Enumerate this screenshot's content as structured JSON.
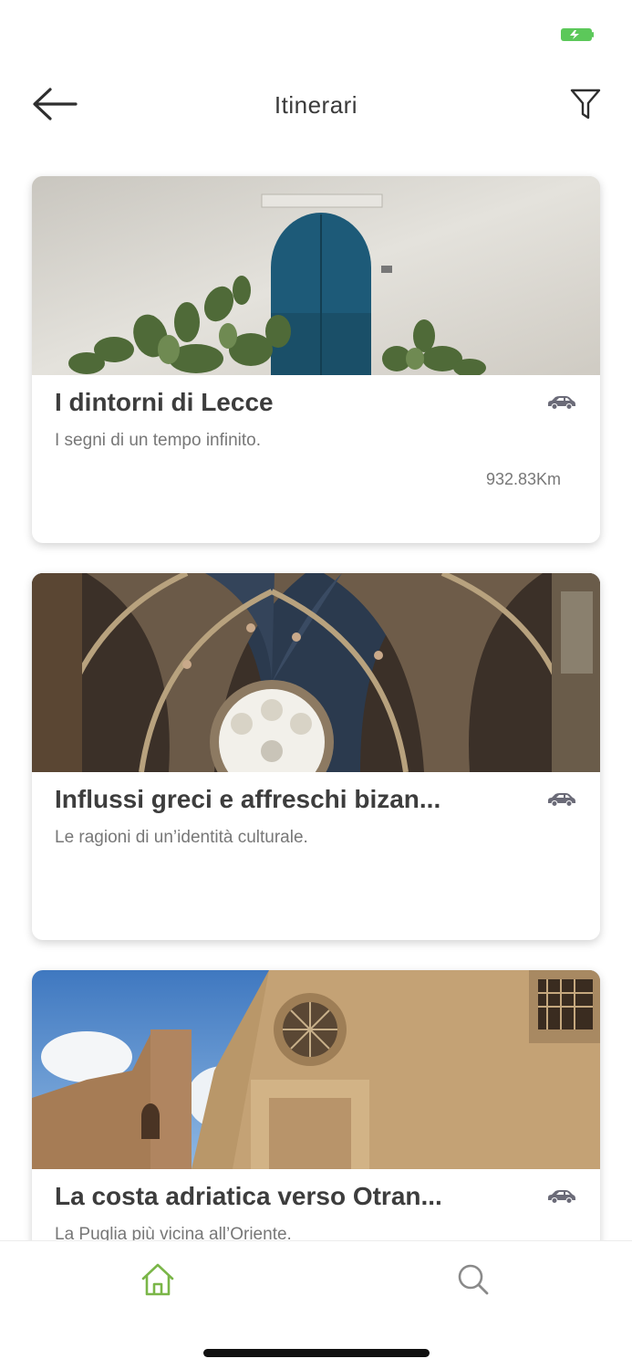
{
  "status_bar": {
    "battery_icon": "battery-charging-icon",
    "battery_color": "#5cc85a"
  },
  "header": {
    "title": "Itinerari",
    "back_icon": "arrow-left-icon",
    "filter_icon": "filter-icon"
  },
  "itineraries": [
    {
      "title": "I dintorni di Lecce",
      "subtitle": "I segni di un tempo infinito.",
      "distance": "932.83Km",
      "transport_icon": "car-icon",
      "image": "whitewashed-wall-blue-door-cactus"
    },
    {
      "title": "Influssi greci e affreschi bizan...",
      "subtitle": "Le ragioni di un’identità culturale.",
      "distance": "",
      "transport_icon": "car-icon",
      "image": "frescoed-vaulted-ceiling"
    },
    {
      "title": "La costa adriatica verso Otran...",
      "subtitle": "La Puglia più vicina all’Oriente.",
      "distance": "",
      "transport_icon": "car-icon",
      "image": "otranto-cathedral-facade"
    }
  ],
  "tab_bar": {
    "home_icon": "home-icon",
    "search_icon": "search-icon",
    "active_color": "#7ab648",
    "inactive_color": "#8a8a8a"
  }
}
